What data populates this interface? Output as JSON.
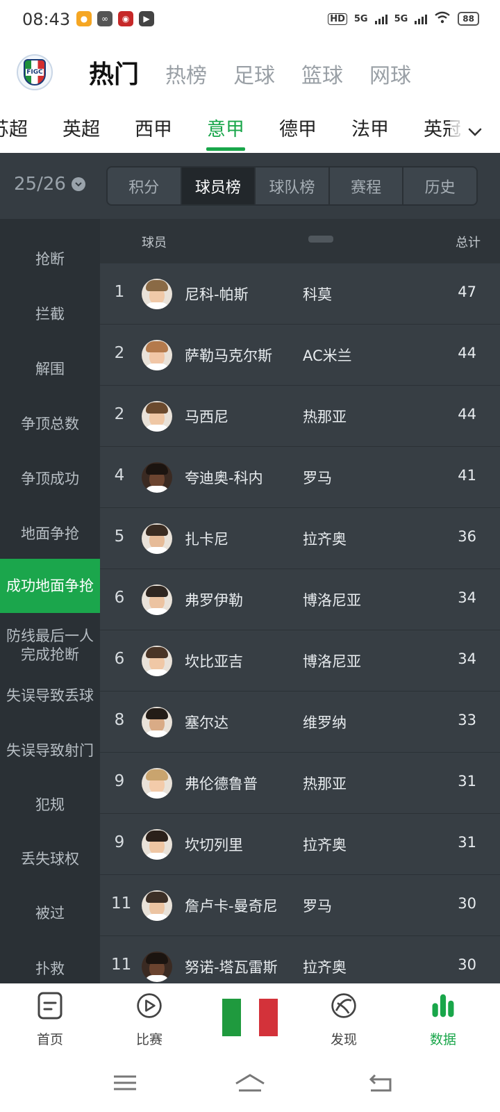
{
  "status_bar": {
    "time": "08:43",
    "network_left": "HD",
    "signal1": "5G",
    "signal2": "5G",
    "battery": "88"
  },
  "header": {
    "logo_text": "FIGC",
    "tabs": [
      {
        "label": "热门",
        "active": true
      },
      {
        "label": "热榜",
        "active": false
      },
      {
        "label": "足球",
        "active": false
      },
      {
        "label": "篮球",
        "active": false
      },
      {
        "label": "网球",
        "active": false
      }
    ]
  },
  "leagues": [
    {
      "label": "苏超"
    },
    {
      "label": "英超"
    },
    {
      "label": "西甲"
    },
    {
      "label": "意甲",
      "active": true
    },
    {
      "label": "德甲"
    },
    {
      "label": "法甲"
    },
    {
      "label": "英冠"
    }
  ],
  "filter": {
    "season": "25/26",
    "segments": [
      {
        "label": "积分"
      },
      {
        "label": "球员榜",
        "active": true
      },
      {
        "label": "球队榜"
      },
      {
        "label": "赛程"
      },
      {
        "label": "历史"
      }
    ]
  },
  "sidebar": {
    "items": [
      {
        "label": "抢断"
      },
      {
        "label": "拦截"
      },
      {
        "label": "解围"
      },
      {
        "label": "争顶总数"
      },
      {
        "label": "争顶成功"
      },
      {
        "label": "地面争抢"
      },
      {
        "label": "成功地面争抢",
        "active": true
      },
      {
        "label": "防线最后一人完成抢断",
        "line1": "防线最后一人",
        "line2": "完成抢断"
      },
      {
        "label": "失误导致丢球"
      },
      {
        "label": "失误导致射门"
      },
      {
        "label": "犯规"
      },
      {
        "label": "丢失球权"
      },
      {
        "label": "被过"
      },
      {
        "label": "扑救"
      }
    ]
  },
  "table": {
    "header": {
      "player": "球员",
      "total": "总计"
    },
    "rows": [
      {
        "rank": "1",
        "name": "尼科-帕斯",
        "team": "科莫",
        "total": "47"
      },
      {
        "rank": "2",
        "name": "萨勒马克尔斯",
        "team": "AC米兰",
        "total": "44"
      },
      {
        "rank": "2",
        "name": "马西尼",
        "team": "热那亚",
        "total": "44"
      },
      {
        "rank": "4",
        "name": "夸迪奥-科内",
        "team": "罗马",
        "total": "41"
      },
      {
        "rank": "5",
        "name": "扎卡尼",
        "team": "拉齐奥",
        "total": "36"
      },
      {
        "rank": "6",
        "name": "弗罗伊勒",
        "team": "博洛尼亚",
        "total": "34"
      },
      {
        "rank": "6",
        "name": "坎比亚吉",
        "team": "博洛尼亚",
        "total": "34"
      },
      {
        "rank": "8",
        "name": "塞尔达",
        "team": "维罗纳",
        "total": "33"
      },
      {
        "rank": "9",
        "name": "弗伦德鲁普",
        "team": "热那亚",
        "total": "31"
      },
      {
        "rank": "9",
        "name": "坎切列里",
        "team": "拉齐奥",
        "total": "31"
      },
      {
        "rank": "11",
        "name": "詹卢卡-曼奇尼",
        "team": "罗马",
        "total": "30"
      },
      {
        "rank": "11",
        "name": "努诺-塔瓦雷斯",
        "team": "拉齐奥",
        "total": "30"
      }
    ]
  },
  "bottom_nav": {
    "items": [
      {
        "label": "首页",
        "icon": "home-doc-icon"
      },
      {
        "label": "比赛",
        "icon": "play-icon"
      },
      {
        "label": "",
        "icon": "italy-flag-icon"
      },
      {
        "label": "发现",
        "icon": "discover-icon"
      },
      {
        "label": "数据",
        "icon": "bar-chart-icon",
        "active": true
      }
    ]
  },
  "colors": {
    "accent": "#19a64a",
    "dark_bg": "#373e44",
    "sidebar_bg": "#2a3035"
  }
}
